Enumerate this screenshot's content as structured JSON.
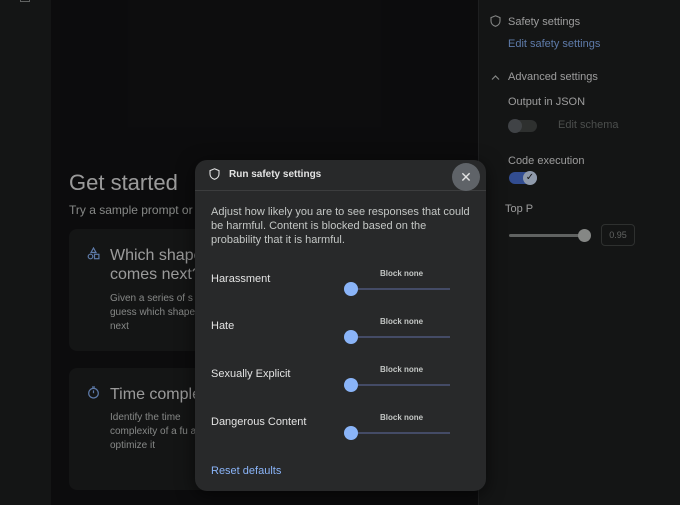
{
  "main": {
    "heading": "Get started",
    "subheading": "Try a sample prompt or",
    "cards": [
      {
        "icon": "shapes-icon",
        "title": "Which shape comes next?",
        "description": "Given a series of s guess which shape next"
      },
      {
        "icon": "timer-icon",
        "title": "Time comple",
        "description": "Identify the time complexity of a fu and optimize it"
      }
    ]
  },
  "right_panel": {
    "safety_settings_label": "Safety settings",
    "edit_safety_link": "Edit safety settings",
    "advanced_settings_label": "Advanced settings",
    "output_json_label": "Output in JSON",
    "output_json_enabled": false,
    "edit_schema_label": "Edit schema",
    "code_execution_label": "Code execution",
    "code_execution_enabled": true,
    "top_p_label": "Top P",
    "top_p_value": "0.95"
  },
  "modal": {
    "title": "Run safety settings",
    "description": "Adjust how likely you are to see responses that could be harmful. Content is blocked based on the probability that it is harmful.",
    "categories": [
      {
        "label": "Harassment",
        "level": "Block none"
      },
      {
        "label": "Hate",
        "level": "Block none"
      },
      {
        "label": "Sexually Explicit",
        "level": "Block none"
      },
      {
        "label": "Dangerous Content",
        "level": "Block none"
      }
    ],
    "reset_label": "Reset defaults"
  },
  "colors": {
    "accent": "#8ab4f8",
    "background": "#131314",
    "panel": "#1e1f20",
    "modal": "#28292a"
  }
}
